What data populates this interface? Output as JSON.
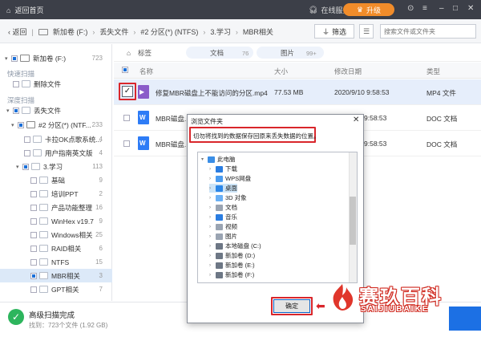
{
  "titlebar": {
    "back_label": "返回首页",
    "service": "在线服务",
    "upgrade": "升级"
  },
  "nav": {
    "back": "返回",
    "crumbs": [
      "新加卷 (F:)",
      "丢失文件",
      "#2 分区(*) (NTFS)",
      "3.学习",
      "MBR相关"
    ],
    "filter": "筛选",
    "search_placeholder": "搜索文件或文件夹"
  },
  "sidebar": {
    "drive": {
      "label": "新加卷 (F:)",
      "count": "723"
    },
    "quick_section": "快速扫描",
    "deleted": "删除文件",
    "deep_section": "深度扫描",
    "lost": {
      "label": "丢失文件",
      "count": "233"
    },
    "partition": {
      "label": "#2 分区(*) (NTF...",
      "count": "233"
    },
    "items": [
      {
        "label": "卡拉OK点歌系统...",
        "count": "4"
      },
      {
        "label": "用户指南英文版",
        "count": "4"
      },
      {
        "label": "3.学习",
        "count": "113"
      },
      {
        "label": "基础",
        "count": "9"
      },
      {
        "label": "培训PPT",
        "count": "2"
      },
      {
        "label": "产品功能整理",
        "count": "16"
      },
      {
        "label": "WinHex v19.7",
        "count": "9"
      },
      {
        "label": "Windows相关",
        "count": "25"
      },
      {
        "label": "RAID相关",
        "count": "6"
      },
      {
        "label": "NTFS",
        "count": "15"
      },
      {
        "label": "MBR相关",
        "count": "3"
      },
      {
        "label": "GPT相关",
        "count": "7"
      }
    ]
  },
  "tabs": [
    {
      "label": "标签",
      "count": ""
    },
    {
      "label": "文档",
      "count": "76"
    },
    {
      "label": "图片",
      "count": "99+"
    }
  ],
  "columns": [
    "名称",
    "大小",
    "修改日期",
    "类型"
  ],
  "files": [
    {
      "name": "修复MBR磁盘上不能访问的分区.mp4",
      "size": "77.53 MB",
      "date": "2020/9/10 9:58:53",
      "type": "MP4 文件"
    },
    {
      "name": "MBR磁盘...",
      "size": "",
      "date": "9:58:53",
      "type": "DOC 文档"
    },
    {
      "name": "MBR磁盘...",
      "size": "",
      "date": "9:58:53",
      "type": "DOC 文档"
    }
  ],
  "status": {
    "title": "高级扫描完成",
    "detail": "找到：723个文件 (1.92 GB)"
  },
  "dialog": {
    "title": "浏览文件夹",
    "hint": "切勿将找到的数据保存回原来丢失数据的位置。",
    "ok": "确定",
    "tree": [
      {
        "label": "此电脑",
        "icon_color": "#3a8ee6"
      },
      {
        "label": "下载",
        "icon_color": "#2a7de1"
      },
      {
        "label": "WPS网盘",
        "icon_color": "#4a9cf0"
      },
      {
        "label": "桌面",
        "icon_color": "#2c87e8"
      },
      {
        "label": "3D 对象",
        "icon_color": "#6ab0f5"
      },
      {
        "label": "文档",
        "icon_color": "#9aa4b2"
      },
      {
        "label": "音乐",
        "icon_color": "#2a7de1"
      },
      {
        "label": "视频",
        "icon_color": "#9aa4b2"
      },
      {
        "label": "图片",
        "icon_color": "#9aa4b2"
      },
      {
        "label": "本地磁盘 (C:)",
        "icon_color": "#6d7785"
      },
      {
        "label": "新加卷 (D:)",
        "icon_color": "#6d7785"
      },
      {
        "label": "新加卷 (E:)",
        "icon_color": "#6d7785"
      },
      {
        "label": "新加卷 (F:)",
        "icon_color": "#6d7785"
      }
    ]
  },
  "watermark": {
    "cn": "赛玖百科",
    "en": "SAIJIUBAIKE"
  },
  "colors": {
    "accent": "#1c70e4",
    "upgrade": "#f18c2a",
    "highlight": "#d9262b",
    "success": "#2db55d"
  }
}
